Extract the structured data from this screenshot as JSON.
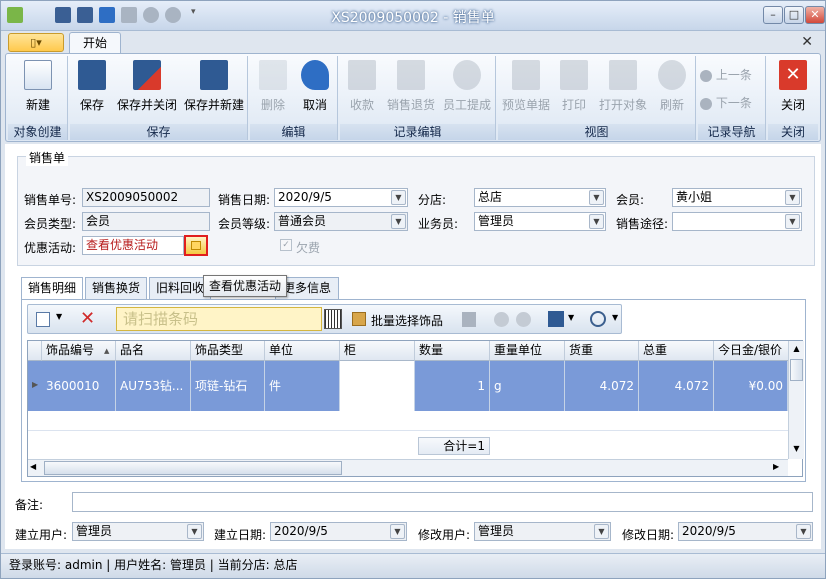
{
  "window": {
    "title": "XS2009050002 - 销售单"
  },
  "ribbon": {
    "app_menu_label": "▯▾",
    "tab": "开始",
    "groups": [
      {
        "label": "对象创建",
        "buttons": [
          "新建"
        ]
      },
      {
        "label": "保存",
        "buttons": [
          "保存",
          "保存并关闭",
          "保存并新建"
        ]
      },
      {
        "label": "编辑",
        "buttons": [
          "删除",
          "取消"
        ]
      },
      {
        "label": "记录编辑",
        "buttons": [
          "收款",
          "销售退货",
          "员工提成"
        ]
      },
      {
        "label": "视图",
        "buttons": [
          "预览单据",
          "打印",
          "打开对象",
          "刷新"
        ]
      },
      {
        "label": "记录导航",
        "buttons": [
          "上一条",
          "下一条"
        ]
      },
      {
        "label": "关闭",
        "buttons": [
          "关闭"
        ]
      }
    ]
  },
  "form": {
    "group_title": "销售单",
    "order_no_label": "销售单号:",
    "order_no": "XS2009050002",
    "date_label": "销售日期:",
    "date": "2020/9/5",
    "branch_label": "分店:",
    "branch": "总店",
    "member_label": "会员:",
    "member": "黄小姐",
    "member_type_label": "会员类型:",
    "member_type": "会员",
    "member_level_label": "会员等级:",
    "member_level": "普通会员",
    "salesman_label": "业务员:",
    "salesman": "管理员",
    "channel_label": "销售途径:",
    "channel": "",
    "promo_label": "优惠活动:",
    "promo": "查看优惠活动",
    "owed_label": "欠费"
  },
  "tooltip": "查看优惠活动",
  "tabs": [
    "销售明细",
    "销售换货",
    "旧料回收",
    "更多信息"
  ],
  "toolbar": {
    "barcode_placeholder": "请扫描条码",
    "batch_label": "批量选择饰品"
  },
  "grid": {
    "columns": [
      "饰品编号",
      "品名",
      "饰品类型",
      "单位",
      "柜",
      "数量",
      "重量单位",
      "货重",
      "总重",
      "今日金/银价"
    ],
    "rows": [
      [
        "3600010",
        "AU753钻...",
        "项链-钻石",
        "件",
        "",
        "1",
        "g",
        "4.072",
        "4.072",
        "¥0.00"
      ]
    ],
    "summary": "合计=1"
  },
  "remark_label": "备注:",
  "footer": {
    "creator_label": "建立用户:",
    "creator": "管理员",
    "created_label": "建立日期:",
    "created": "2020/9/5",
    "modifier_label": "修改用户:",
    "modifier": "管理员",
    "modified_label": "修改日期:",
    "modified": "2020/9/5"
  },
  "status": {
    "text": "登录账号: admin  |  用户姓名: 管理员  |  当前分店: 总店"
  },
  "colors": {
    "accent": "#6b8fd8",
    "selected_row": "#7a9ad8",
    "tab_orange": "#ffc94d"
  }
}
